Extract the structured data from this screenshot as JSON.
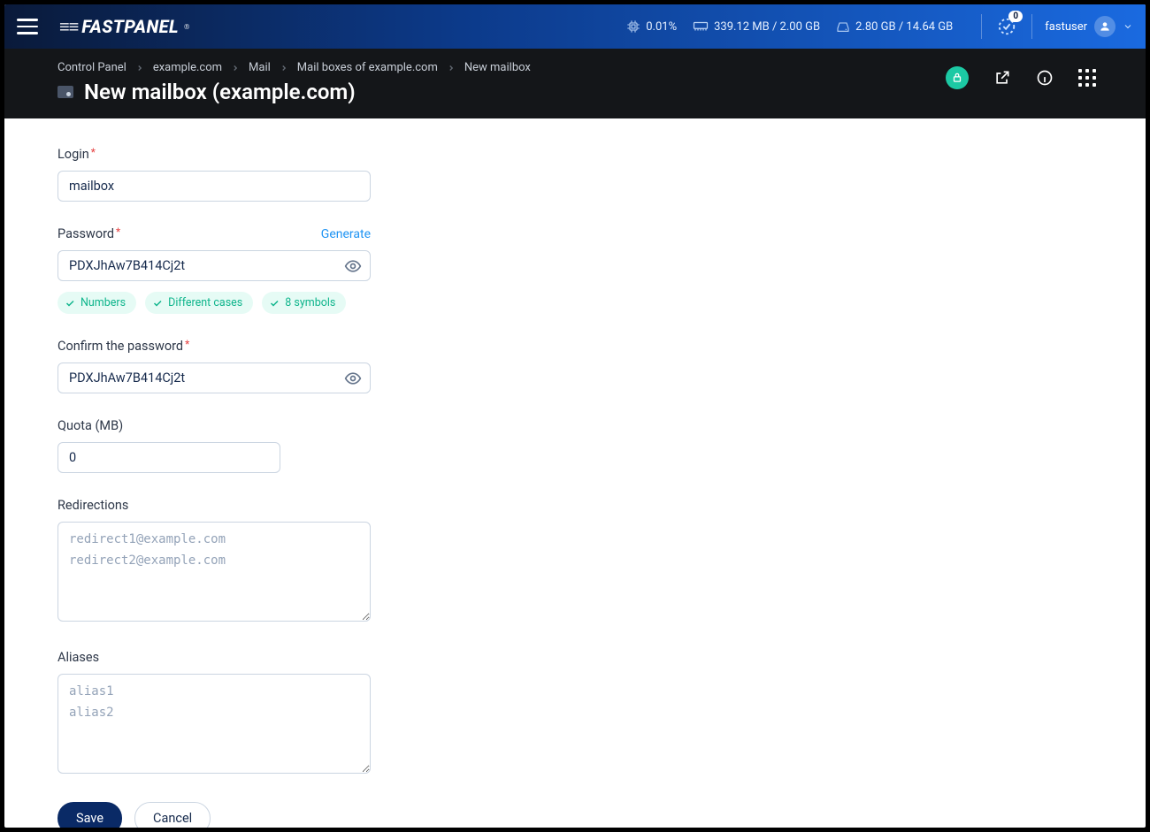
{
  "brand": "FASTPANEL",
  "topbar": {
    "cpu": "0.01%",
    "ram": "339.12 MB / 2.00 GB",
    "disk": "2.80 GB / 14.64 GB",
    "notif_count": "0",
    "username": "fastuser"
  },
  "breadcrumb": [
    "Control Panel",
    "example.com",
    "Mail",
    "Mail boxes of example.com",
    "New mailbox"
  ],
  "page_title": "New mailbox (example.com)",
  "form": {
    "login": {
      "label": "Login",
      "value": "mailbox"
    },
    "password": {
      "label": "Password",
      "generate": "Generate",
      "value": "PDXJhAw7B414Cj2t"
    },
    "password_checks": [
      "Numbers",
      "Different cases",
      "8 symbols"
    ],
    "confirm": {
      "label": "Confirm the password",
      "value": "PDXJhAw7B414Cj2t"
    },
    "quota": {
      "label": "Quota (MB)",
      "value": "0"
    },
    "redirections": {
      "label": "Redirections",
      "placeholder": "redirect1@example.com\nredirect2@example.com"
    },
    "aliases": {
      "label": "Aliases",
      "placeholder": "alias1\nalias2"
    }
  },
  "actions": {
    "save": "Save",
    "cancel": "Cancel"
  }
}
